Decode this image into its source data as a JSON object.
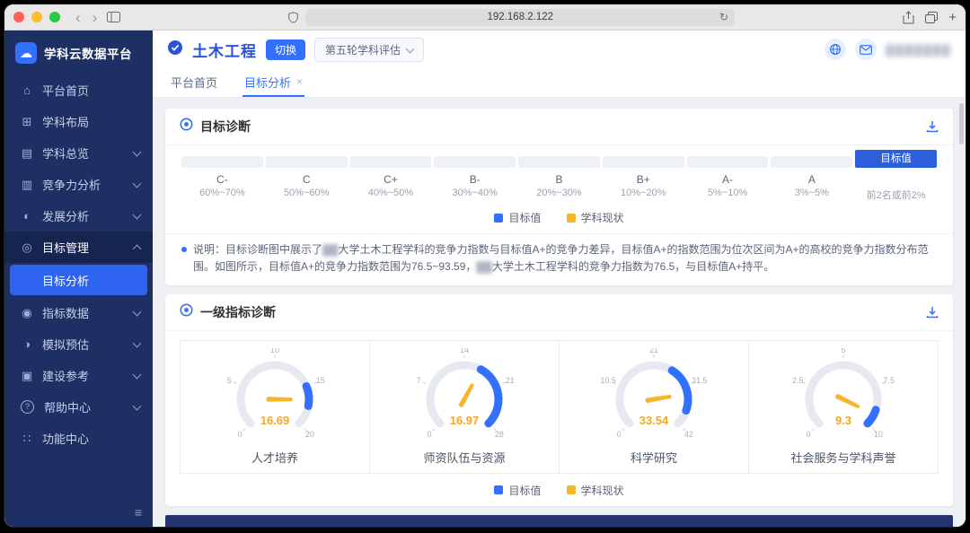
{
  "window": {
    "url": "192.168.2.122"
  },
  "brand": {
    "name": "学科云数据平台"
  },
  "sidebar": {
    "items": [
      {
        "key": "home",
        "label": "平台首页",
        "icon": "home-icon"
      },
      {
        "key": "discipline-layout",
        "label": "学科布局",
        "icon": "layout-icon"
      },
      {
        "key": "discipline-overview",
        "label": "学科总览",
        "icon": "overview-icon",
        "chevron": "down"
      },
      {
        "key": "competitiveness-analysis",
        "label": "竞争力分析",
        "icon": "chart-icon",
        "chevron": "down"
      },
      {
        "key": "development-analysis",
        "label": "发展分析",
        "icon": "trend-icon",
        "chevron": "down"
      },
      {
        "key": "goal-management",
        "label": "目标管理",
        "icon": "target-icon",
        "chevron": "up",
        "state": "expanded"
      },
      {
        "key": "goal-analysis",
        "label": "目标分析",
        "type": "sub",
        "state": "active"
      },
      {
        "key": "indicator-data",
        "label": "指标数据",
        "icon": "data-icon",
        "chevron": "down"
      },
      {
        "key": "simulation-estimate",
        "label": "模拟预估",
        "icon": "simulate-icon",
        "chevron": "down"
      },
      {
        "key": "construction-reference",
        "label": "建设参考",
        "icon": "reference-icon",
        "chevron": "down"
      },
      {
        "key": "help-center",
        "label": "帮助中心",
        "icon": "help-icon",
        "chevron": "down"
      },
      {
        "key": "function-center",
        "label": "功能中心",
        "icon": "apps-icon"
      }
    ]
  },
  "header": {
    "discipline": "土木工程",
    "switch_button": "切换",
    "evaluation_round": "第五轮学科评估",
    "user_redacted": "▓▓▓▓▓▓▓"
  },
  "tabs": [
    {
      "key": "home",
      "label": "平台首页"
    },
    {
      "key": "goal-analysis",
      "label": "目标分析",
      "active": true,
      "closable": true
    }
  ],
  "legend": {
    "target": "目标值",
    "current": "学科现状"
  },
  "goal_card": {
    "title": "目标诊断",
    "note_parts": {
      "p1": "说明：目标诊断图中展示了",
      "p2": "大学土木工程学科的竞争力指数与目标值A+的竞争力差异，目标值A+的指数范围为位次区间为A+的高校的竞争力指数分布范围。如图所示，目标值A+的竞争力指数范围为76.5~93.59，",
      "p3": "大学土木工程学科的竞争力指数为76.5，与目标值A+持平。",
      "redacted": "▓▓"
    }
  },
  "indicator_card": {
    "title": "一级指标诊断"
  },
  "chart_data": [
    {
      "type": "table",
      "title": "目标诊断",
      "subtitle": "等级位次区间标尺，目标值标记位于最高档",
      "legend": [
        "目标值",
        "学科现状"
      ],
      "bands": [
        {
          "grade": "C-",
          "range": "60%~70%"
        },
        {
          "grade": "C",
          "range": "50%~60%"
        },
        {
          "grade": "C+",
          "range": "40%~50%"
        },
        {
          "grade": "B-",
          "range": "30%~40%"
        },
        {
          "grade": "B",
          "range": "20%~30%"
        },
        {
          "grade": "B+",
          "range": "10%~20%"
        },
        {
          "grade": "A-",
          "range": "5%~10%"
        },
        {
          "grade": "A",
          "range": "3%~5%"
        },
        {
          "grade": "",
          "range": "前2名或前2%",
          "marker": "目标值"
        }
      ],
      "target_competitiveness_range": "76.5~93.59",
      "current_competitiveness": 76.5
    },
    {
      "type": "gauge",
      "title": "一级指标诊断",
      "legend": [
        "目标值",
        "学科现状"
      ],
      "gauges": [
        {
          "label": "人才培养",
          "value": 16.69,
          "min": 0,
          "max": 20,
          "ticks": [
            0,
            5,
            10,
            15,
            20
          ],
          "target_range": [
            15,
            17.5
          ]
        },
        {
          "label": "师资队伍与资源",
          "value": 16.97,
          "min": 0,
          "max": 28,
          "ticks": [
            0,
            7,
            14,
            21,
            28
          ],
          "target_range": [
            17,
            28
          ]
        },
        {
          "label": "科学研究",
          "value": 33.54,
          "min": 0,
          "max": 42,
          "ticks": [
            0,
            10.5,
            21,
            31.5,
            42
          ],
          "target_range": [
            26,
            38
          ]
        },
        {
          "label": "社会服务与学科声誉",
          "value": 9.3,
          "min": 0,
          "max": 10,
          "ticks": [
            0,
            2.5,
            5,
            7.5,
            10
          ],
          "target_range": [
            9,
            10
          ]
        }
      ]
    }
  ],
  "colors": {
    "primary": "#3370ff",
    "target_blue": "#2b5fdc",
    "current_yellow": "#f7b52c",
    "value_orange": "#f5a623",
    "sidebar_bg": "#1e2f63"
  }
}
